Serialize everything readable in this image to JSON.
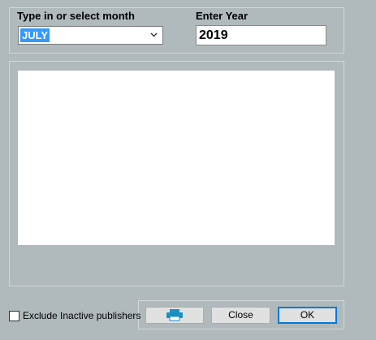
{
  "month": {
    "label": "Type in or select month",
    "value": "JULY"
  },
  "year": {
    "label": "Enter Year",
    "value": "2019"
  },
  "options": {
    "exclude_inactive_label": "Exclude Inactive publishers",
    "exclude_inactive_checked": false
  },
  "buttons": {
    "print_icon": "printer-icon",
    "close_label": "Close",
    "ok_label": "OK"
  },
  "colors": {
    "background": "#b0b9bc",
    "selection": "#3399ff",
    "print_icon": "#1a8fc4",
    "ok_border": "#0078d7"
  }
}
